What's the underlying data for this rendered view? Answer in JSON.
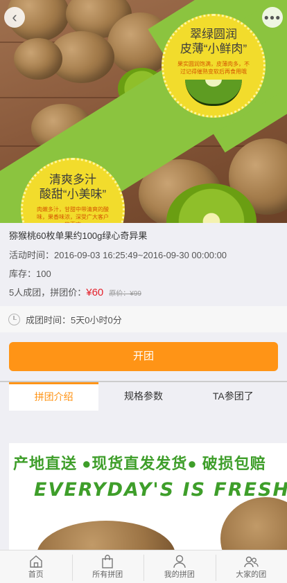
{
  "hero": {
    "badge_top": {
      "line1": "翠绿圆润",
      "line2": "皮薄“小鲜肉”",
      "desc": "果实圆润饱满，皮薄肉多，不过记得催熟变软后再食用哦"
    },
    "badge_bottom": {
      "line1": "清爽多汁",
      "line2": "酸甜“小美味”",
      "desc": "肉嫩多汁，甘甜中带清爽的酸味，果香味浓，深受广大客户的喜欢"
    }
  },
  "product": {
    "title": "猕猴桃60枚单果约100g绿心奇异果",
    "activity_label": "活动时间：",
    "activity_time": "2016-09-03 16:25:49~2016-09-30 00:00:00",
    "stock_label": "库存：",
    "stock": "100",
    "group_label": "5人成团，拼团价：",
    "group_price": "¥60",
    "original_price": "原价：¥99"
  },
  "group_time": {
    "label": "成团时间：",
    "value": "5天0小时0分"
  },
  "open_button": "开团",
  "tabs": [
    {
      "label": "拼团介绍",
      "active": true
    },
    {
      "label": "规格参数",
      "active": false
    },
    {
      "label": "TA参团了",
      "active": false
    }
  ],
  "promo": {
    "line1": "产地直送 ●现货直发发货● 破损包赔",
    "line2": "EVERYDAY'S IS FRESH!"
  },
  "bottom_nav": [
    {
      "label": "首页",
      "icon": "home-icon"
    },
    {
      "label": "所有拼团",
      "icon": "bag-icon"
    },
    {
      "label": "我的拼团",
      "icon": "user-icon"
    },
    {
      "label": "大家的团",
      "icon": "users-icon"
    }
  ],
  "colors": {
    "accent": "#ff9416",
    "price": "#e4202a",
    "banner_green": "#8bc43f",
    "promo_green": "#3e9e2a"
  }
}
